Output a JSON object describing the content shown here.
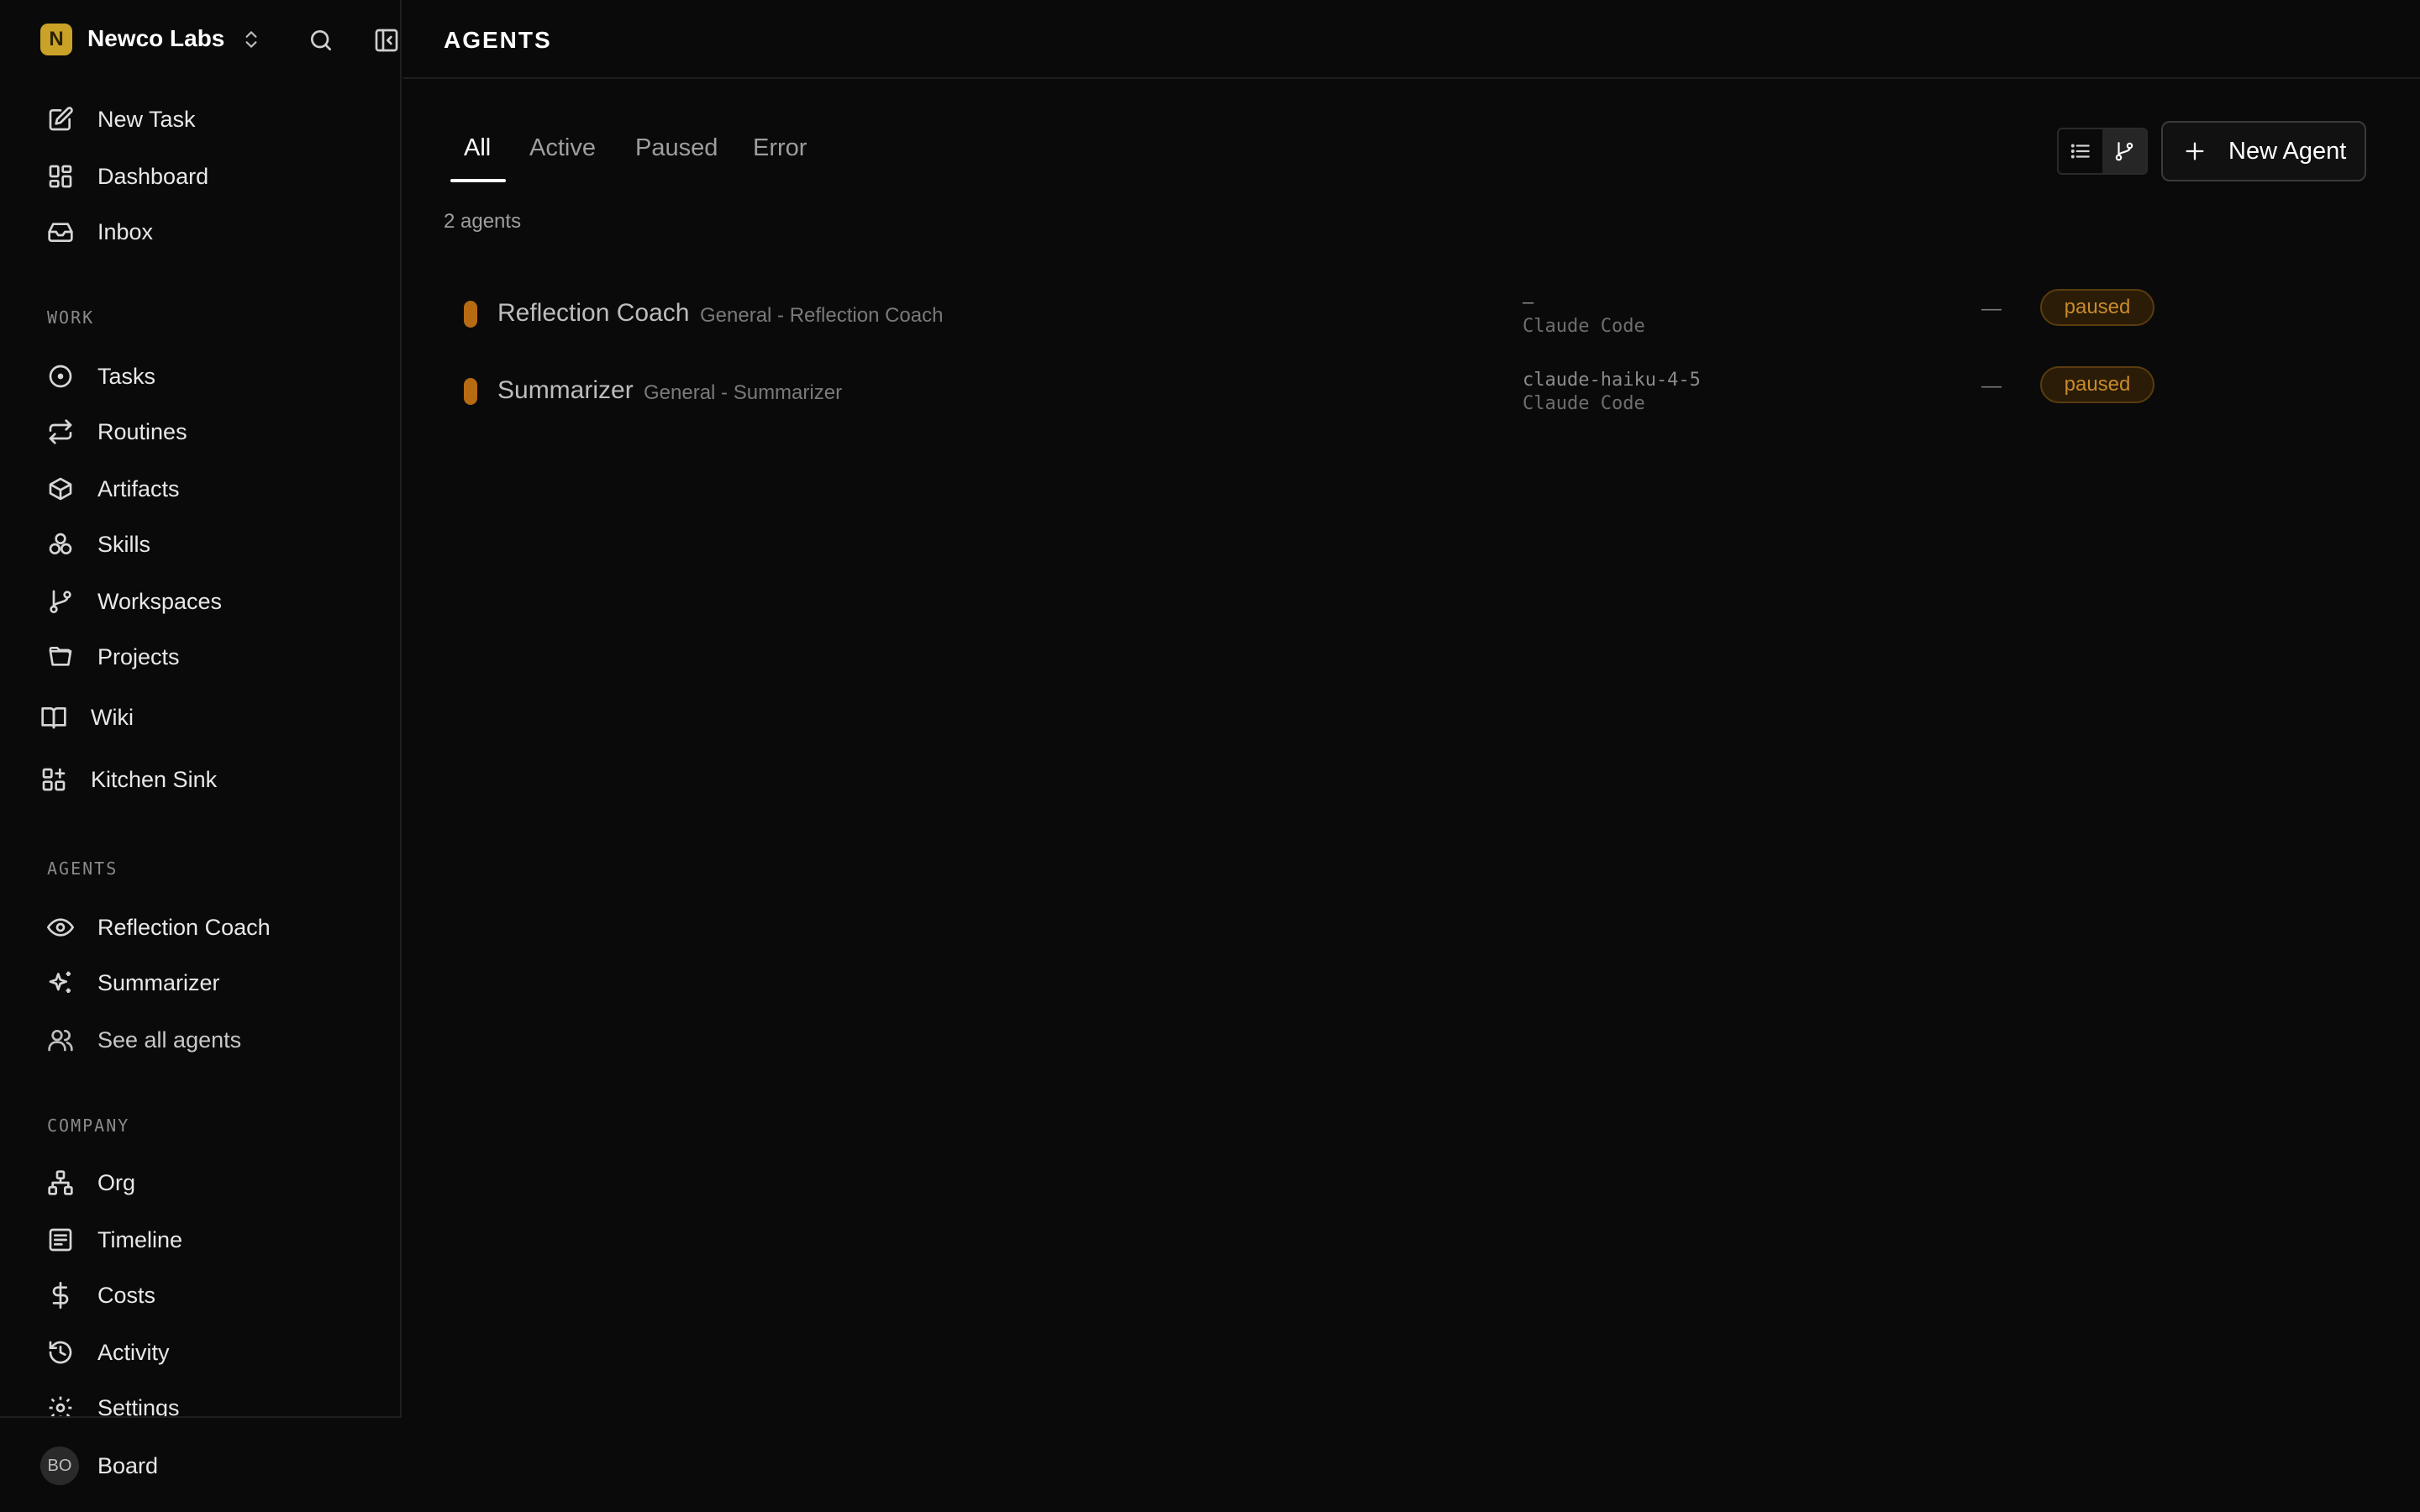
{
  "company": {
    "initial": "N",
    "name": "Newco Labs"
  },
  "nav_primary": [
    {
      "label": "New Task",
      "icon": "edit-icon"
    },
    {
      "label": "Dashboard",
      "icon": "dashboard-icon"
    },
    {
      "label": "Inbox",
      "icon": "inbox-icon"
    }
  ],
  "sections": {
    "work": "WORK",
    "agents": "AGENTS",
    "company": "COMPANY"
  },
  "nav_work": [
    {
      "label": "Tasks",
      "icon": "circle-dot-icon"
    },
    {
      "label": "Routines",
      "icon": "repeat-icon"
    },
    {
      "label": "Artifacts",
      "icon": "box-icon"
    },
    {
      "label": "Skills",
      "icon": "skills-icon"
    },
    {
      "label": "Workspaces",
      "icon": "git-branch-icon"
    },
    {
      "label": "Projects",
      "icon": "folder-open-icon"
    },
    {
      "label": "Wiki",
      "icon": "book-icon"
    },
    {
      "label": "Kitchen Sink",
      "icon": "grid-plus-icon"
    }
  ],
  "nav_agents": [
    {
      "label": "Reflection Coach",
      "icon": "eye-icon"
    },
    {
      "label": "Summarizer",
      "icon": "sparkles-icon"
    },
    {
      "label": "See all agents",
      "icon": "users-icon"
    }
  ],
  "nav_company": [
    {
      "label": "Org",
      "icon": "org-icon"
    },
    {
      "label": "Timeline",
      "icon": "timeline-icon"
    },
    {
      "label": "Costs",
      "icon": "dollar-icon"
    },
    {
      "label": "Activity",
      "icon": "history-icon"
    },
    {
      "label": "Settings",
      "icon": "gear-icon"
    }
  ],
  "footer": {
    "initials": "BO",
    "name": "Board"
  },
  "page": {
    "title": "AGENTS",
    "tabs": [
      "All",
      "Active",
      "Paused",
      "Error"
    ],
    "active_tab": "All",
    "count": "2 agents",
    "new_agent_label": "New Agent"
  },
  "agents": [
    {
      "name": "Reflection Coach",
      "subtitle": "General - Reflection Coach",
      "model": "—",
      "runtime": "Claude Code",
      "last": "—",
      "status": "paused"
    },
    {
      "name": "Summarizer",
      "subtitle": "General - Summarizer",
      "model": "claude-haiku-4-5",
      "runtime": "Claude Code",
      "last": "—",
      "status": "paused"
    }
  ],
  "colors": {
    "background": "#0a0a0a",
    "accent_status": "#c98a2a",
    "logo": "#c9a227"
  }
}
